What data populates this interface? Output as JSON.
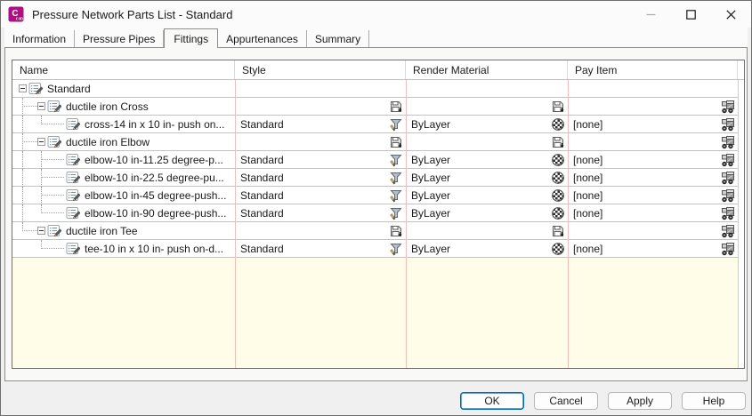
{
  "window": {
    "title": "Pressure Network Parts List - Standard",
    "app_icon": "civil3d-app-icon",
    "controls": [
      "minimize",
      "maximize",
      "close"
    ]
  },
  "tabs": {
    "active": "Fittings",
    "items": [
      "Information",
      "Pressure Pipes",
      "Fittings",
      "Appurtenances",
      "Summary"
    ]
  },
  "table": {
    "headers": [
      "Name",
      "Style",
      "Render Material",
      "Pay Item"
    ],
    "row_icon": "parts-list-icon",
    "rows": [
      {
        "level": 0,
        "type": "group",
        "name": "Standard"
      },
      {
        "level": 1,
        "type": "group",
        "name": "ductile iron Cross",
        "style_icon": "save-override-icon",
        "render_icon": "save-override-icon",
        "pay_icon": "pay-item-icon"
      },
      {
        "level": 2,
        "type": "part",
        "name": "cross-14 in x 10 in- push on...",
        "style": "Standard",
        "style_icon": "style-picker-icon",
        "render_material": "ByLayer",
        "render_icon": "render-material-icon",
        "pay_item": "[none]",
        "pay_icon": "pay-item-icon"
      },
      {
        "level": 1,
        "type": "group",
        "name": "ductile iron Elbow",
        "style_icon": "save-override-icon",
        "render_icon": "save-override-icon",
        "pay_icon": "pay-item-icon"
      },
      {
        "level": 2,
        "type": "part",
        "name": "elbow-10 in-11.25 degree-p...",
        "style": "Standard",
        "style_icon": "style-picker-icon",
        "render_material": "ByLayer",
        "render_icon": "render-material-icon",
        "pay_item": "[none]",
        "pay_icon": "pay-item-icon"
      },
      {
        "level": 2,
        "type": "part",
        "name": "elbow-10 in-22.5 degree-pu...",
        "style": "Standard",
        "style_icon": "style-picker-icon",
        "render_material": "ByLayer",
        "render_icon": "render-material-icon",
        "pay_item": "[none]",
        "pay_icon": "pay-item-icon"
      },
      {
        "level": 2,
        "type": "part",
        "name": "elbow-10 in-45 degree-push...",
        "style": "Standard",
        "style_icon": "style-picker-icon",
        "render_material": "ByLayer",
        "render_icon": "render-material-icon",
        "pay_item": "[none]",
        "pay_icon": "pay-item-icon"
      },
      {
        "level": 2,
        "type": "part",
        "name": "elbow-10 in-90 degree-push...",
        "style": "Standard",
        "style_icon": "style-picker-icon",
        "render_material": "ByLayer",
        "render_icon": "render-material-icon",
        "pay_item": "[none]",
        "pay_icon": "pay-item-icon"
      },
      {
        "level": 1,
        "type": "group",
        "name": "ductile iron Tee",
        "style_icon": "save-override-icon",
        "render_icon": "save-override-icon",
        "pay_icon": "pay-item-icon"
      },
      {
        "level": 2,
        "type": "part",
        "name": "tee-10 in x 10 in- push on-d...",
        "style": "Standard",
        "style_icon": "style-picker-icon",
        "render_material": "ByLayer",
        "render_icon": "render-material-icon",
        "pay_item": "[none]",
        "pay_icon": "pay-item-icon"
      }
    ]
  },
  "footer": {
    "buttons": [
      {
        "label": "OK",
        "default": true
      },
      {
        "label": "Cancel",
        "default": false
      },
      {
        "label": "Apply",
        "default": false
      },
      {
        "label": "Help",
        "default": false
      }
    ]
  },
  "colors": {
    "accent": "#0067C0",
    "brand": "#B00F82",
    "canvas": "#FFFDE7",
    "row-line": "#A9C9DE",
    "col-line": "#F2BDBD",
    "page-bg": "#F9F9F7",
    "chrome-bg": "#FBFBFB",
    "dialog-bg": "#F0F0F0"
  }
}
